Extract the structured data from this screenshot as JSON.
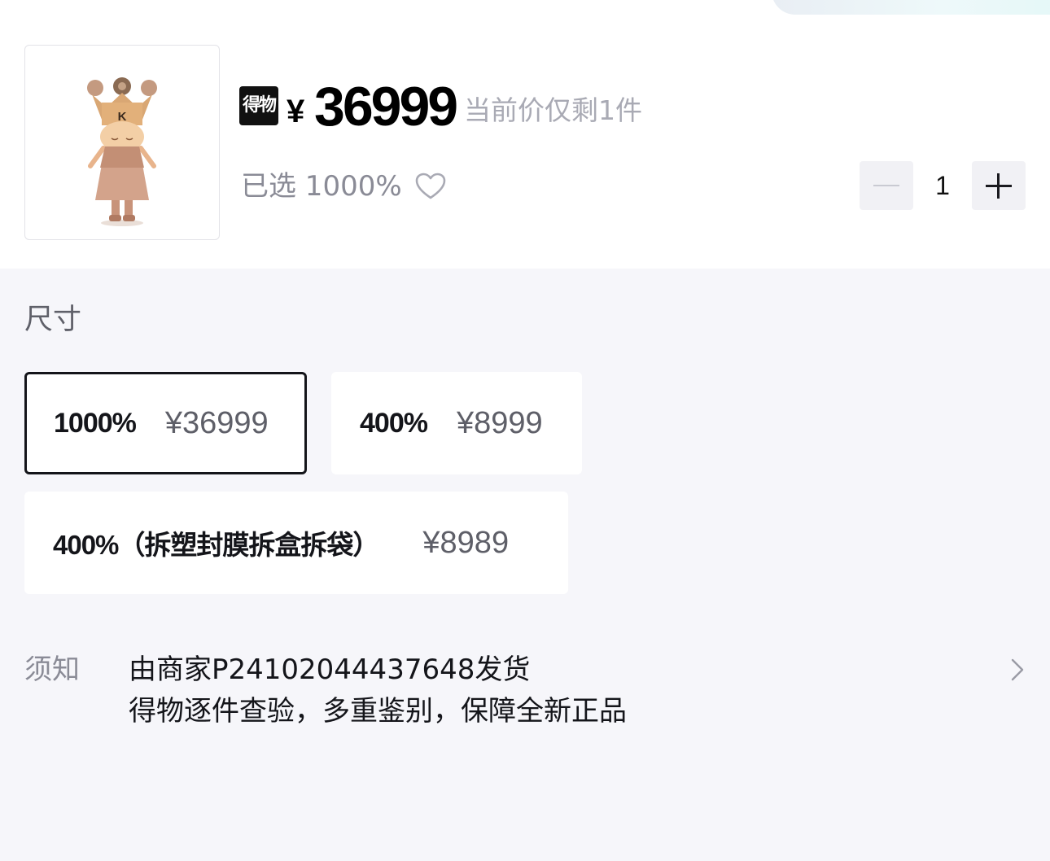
{
  "product": {
    "brand_logo_text": "得物",
    "currency_symbol": "¥",
    "price": "36999",
    "price_note": "当前价仅剩1件",
    "selected_text": "已选 1000%",
    "thumbnail_icon": "figure-with-crown-image",
    "thumbnail_letter": "K"
  },
  "quantity": {
    "value": "1",
    "minus_icon": "minus-icon",
    "plus_icon": "plus-icon"
  },
  "size_section": {
    "label": "尺寸",
    "options": [
      {
        "size": "1000%",
        "price": "¥36999",
        "selected": true
      },
      {
        "size": "400%",
        "price": "¥8999",
        "selected": false
      },
      {
        "size": "400%（拆塑封膜拆盒拆袋）",
        "price": "¥8989",
        "selected": false
      }
    ]
  },
  "notice": {
    "label": "须知",
    "line1": "由商家P24102044437648发货",
    "line2": "得物逐件查验，多重鉴别，保障全新正品"
  },
  "colors": {
    "page_bg": "#f6f6fa",
    "card_bg": "#ffffff",
    "text_primary": "#14151a",
    "text_secondary": "#a9aab4"
  }
}
